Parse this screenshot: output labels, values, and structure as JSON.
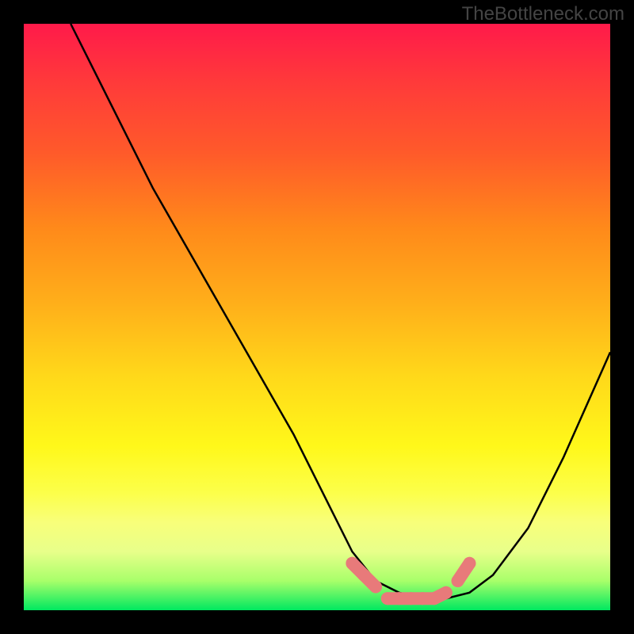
{
  "watermark": "TheBottleneck.com",
  "chart_data": {
    "type": "line",
    "title": "",
    "xlabel": "",
    "ylabel": "",
    "xlim": [
      0,
      100
    ],
    "ylim": [
      0,
      100
    ],
    "series": [
      {
        "name": "curve",
        "x": [
          8,
          15,
          22,
          30,
          38,
          46,
          52,
          56,
          60,
          64,
          68,
          72,
          76,
          80,
          86,
          92,
          100
        ],
        "y": [
          100,
          86,
          72,
          58,
          44,
          30,
          18,
          10,
          5,
          3,
          2,
          2,
          3,
          6,
          14,
          26,
          44
        ]
      },
      {
        "name": "trough-marks-left",
        "x": [
          56,
          58,
          60
        ],
        "y": [
          8,
          6,
          4
        ]
      },
      {
        "name": "trough-marks-center",
        "x": [
          62,
          64,
          66,
          68,
          70,
          72
        ],
        "y": [
          2,
          2,
          2,
          2,
          2,
          3
        ]
      },
      {
        "name": "trough-marks-right",
        "x": [
          74,
          76
        ],
        "y": [
          5,
          8
        ]
      }
    ],
    "legend": false,
    "grid": false
  },
  "colors": {
    "background_frame": "#000000",
    "curve": "#000000",
    "marks": "#E87A7A"
  }
}
